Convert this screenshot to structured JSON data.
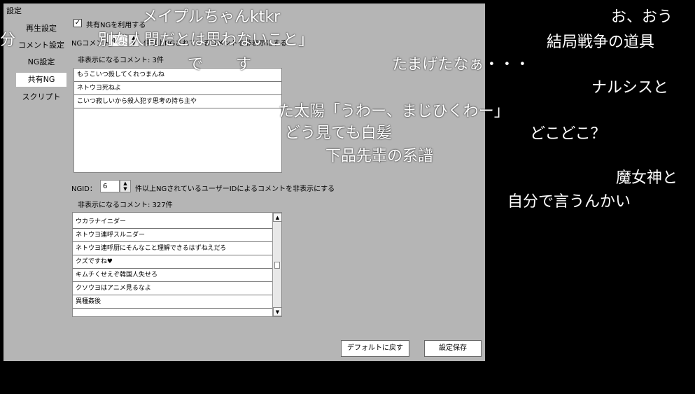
{
  "settings": {
    "title": "設定",
    "tabs": [
      {
        "label": "再生設定"
      },
      {
        "label": "コメント設定"
      },
      {
        "label": "NG設定"
      },
      {
        "label": "共有NG"
      },
      {
        "label": "スクリプト"
      }
    ]
  },
  "shared_ng": {
    "use_label": "共有NGを利用する",
    "use_checked": "✓",
    "ng_comment_label": "NGコメント",
    "ng_comment_value": "4",
    "ng_comment_suffix": "件以上NGされているコメントを非表示にする",
    "hidden_comments": "非表示になるコメント: 3件",
    "comments": [
      "もうこいつ殺してくれつまんね",
      "ネトウヨ死ねよ",
      "こいつ寂しいから殺人犯す思考の持ち主や"
    ],
    "ngid_label": "NGID：",
    "ngid_value": "6",
    "ngid_suffix": "件以上NGされているユーザーIDによるコメントを非表示にする",
    "hidden_ids": "非表示になるコメント: 327件",
    "id_comments": [
      "ウカラナイニダー",
      "ネトウヨ連呼スルニダー",
      "ネトウヨ連呼厨にそんなこと理解できるはずねえだろ",
      "クズですね♥",
      "キムチくせえぞ韓国人失せろ",
      "クソウヨはアニメ見るなよ",
      "異種姦後"
    ]
  },
  "buttons": {
    "default": "デフォルトに戻す",
    "save": "設定保存"
  },
  "overlay_comments": [
    "メイプルちゃんktkr",
    "お、おう",
    "別な人間だとは思わないこと」",
    "結局戦争の道具",
    "たまげたなぁ・・・",
    "で",
    "す",
    "ナルシスと",
    "た太陽「うわー、まじひくわー」",
    "どう見ても白髪",
    "どこどこ？",
    "下品先輩の系譜",
    "魔女神と",
    "自分で言うんかい",
    "分"
  ]
}
